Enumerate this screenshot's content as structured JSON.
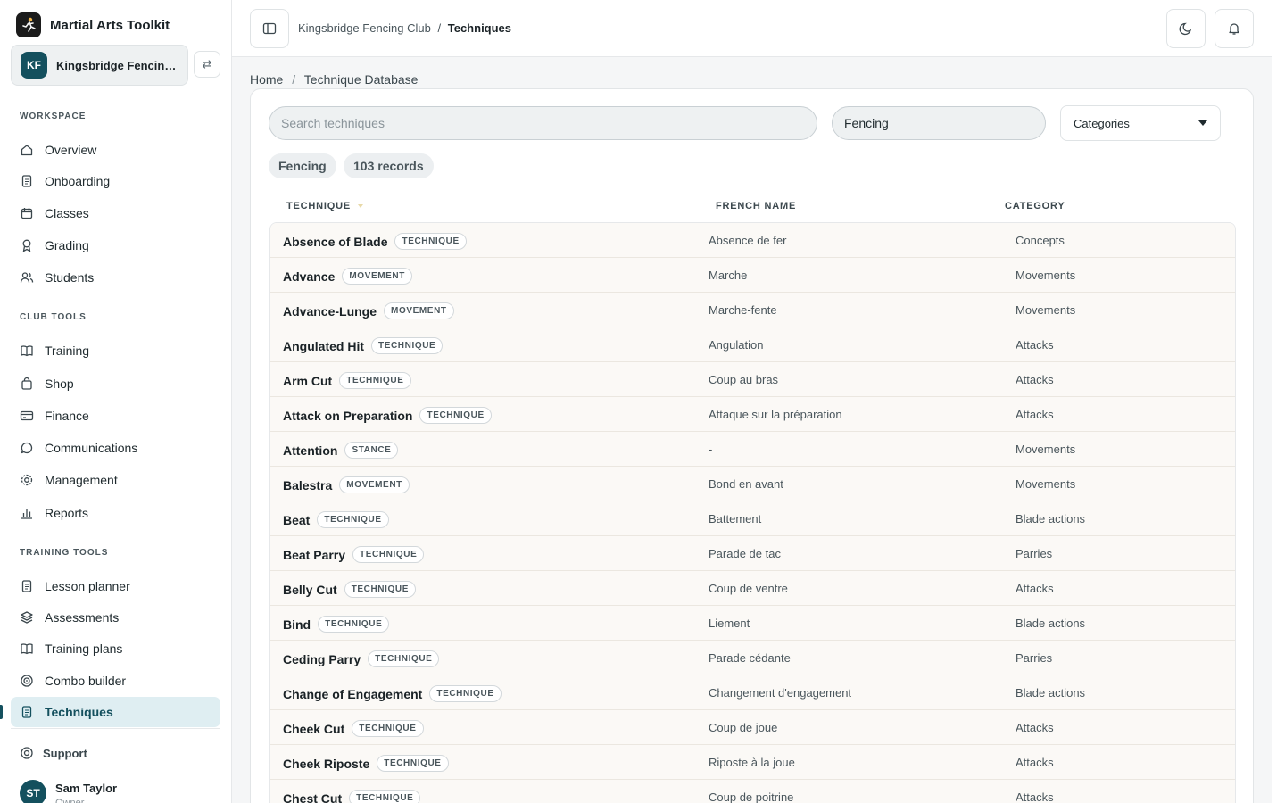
{
  "app": {
    "name": "Martial Arts Toolkit"
  },
  "club": {
    "initials": "KF",
    "name": "Kingsbridge Fencing Club"
  },
  "sidebar": {
    "sections": {
      "workspace": "WORKSPACE",
      "club_tools": "CLUB TOOLS",
      "training_tools": "TRAINING TOOLS"
    },
    "items": [
      {
        "label": "Overview",
        "icon": "home-icon"
      },
      {
        "label": "Onboarding",
        "icon": "document-icon"
      },
      {
        "label": "Classes",
        "icon": "calendar-icon"
      },
      {
        "label": "Grading",
        "icon": "award-icon"
      },
      {
        "label": "Students",
        "icon": "users-icon"
      },
      {
        "label": "Training",
        "icon": "book-icon"
      },
      {
        "label": "Shop",
        "icon": "bag-icon"
      },
      {
        "label": "Finance",
        "icon": "card-icon"
      },
      {
        "label": "Communications",
        "icon": "chat-icon"
      },
      {
        "label": "Management",
        "icon": "gear-icon"
      },
      {
        "label": "Reports",
        "icon": "bar-chart-icon"
      },
      {
        "label": "Lesson planner",
        "icon": "document-icon"
      },
      {
        "label": "Assessments",
        "icon": "layers-icon"
      },
      {
        "label": "Training plans",
        "icon": "book-icon"
      },
      {
        "label": "Combo builder",
        "icon": "target-icon"
      },
      {
        "label": "Techniques",
        "icon": "document-icon",
        "active": true
      }
    ],
    "support": "Support",
    "user": {
      "initials": "ST",
      "name": "Sam Taylor",
      "role": "Owner"
    }
  },
  "topbar": {
    "crumb_parent": "Kingsbridge Fencing Club",
    "crumb_sep": "/",
    "crumb_current": "Techniques"
  },
  "page": {
    "crumb_home": "Home",
    "crumb_sep": "/",
    "crumb_current": "Technique Database"
  },
  "filters": {
    "search_placeholder": "Search techniques",
    "discipline": "Fencing",
    "categories_label": "Categories",
    "chip_discipline": "Fencing",
    "chip_count": "103 records"
  },
  "table": {
    "columns": [
      "TECHNIQUE",
      "FRENCH NAME",
      "CATEGORY"
    ],
    "rows": [
      {
        "name": "Absence of Blade",
        "type": "TECHNIQUE",
        "french": "Absence de fer",
        "category": "Concepts"
      },
      {
        "name": "Advance",
        "type": "MOVEMENT",
        "french": "Marche",
        "category": "Movements"
      },
      {
        "name": "Advance-Lunge",
        "type": "MOVEMENT",
        "french": "Marche-fente",
        "category": "Movements"
      },
      {
        "name": "Angulated Hit",
        "type": "TECHNIQUE",
        "french": "Angulation",
        "category": "Attacks"
      },
      {
        "name": "Arm Cut",
        "type": "TECHNIQUE",
        "french": "Coup au bras",
        "category": "Attacks"
      },
      {
        "name": "Attack on Preparation",
        "type": "TECHNIQUE",
        "french": "Attaque sur la préparation",
        "category": "Attacks"
      },
      {
        "name": "Attention",
        "type": "STANCE",
        "french": "-",
        "category": "Movements"
      },
      {
        "name": "Balestra",
        "type": "MOVEMENT",
        "french": "Bond en avant",
        "category": "Movements"
      },
      {
        "name": "Beat",
        "type": "TECHNIQUE",
        "french": "Battement",
        "category": "Blade actions"
      },
      {
        "name": "Beat Parry",
        "type": "TECHNIQUE",
        "french": "Parade de tac",
        "category": "Parries"
      },
      {
        "name": "Belly Cut",
        "type": "TECHNIQUE",
        "french": "Coup de ventre",
        "category": "Attacks"
      },
      {
        "name": "Bind",
        "type": "TECHNIQUE",
        "french": "Liement",
        "category": "Blade actions"
      },
      {
        "name": "Ceding Parry",
        "type": "TECHNIQUE",
        "french": "Parade cédante",
        "category": "Parries"
      },
      {
        "name": "Change of Engagement",
        "type": "TECHNIQUE",
        "french": "Changement d'engagement",
        "category": "Blade actions"
      },
      {
        "name": "Cheek Cut",
        "type": "TECHNIQUE",
        "french": "Coup de joue",
        "category": "Attacks"
      },
      {
        "name": "Cheek Riposte",
        "type": "TECHNIQUE",
        "french": "Riposte à la joue",
        "category": "Attacks"
      },
      {
        "name": "Chest Cut",
        "type": "TECHNIQUE",
        "french": "Coup de poitrine",
        "category": "Attacks"
      }
    ]
  },
  "colors": {
    "accent": "#14505e",
    "active_bg": "#dfeef2",
    "row_bg": "#fbf9f6"
  }
}
